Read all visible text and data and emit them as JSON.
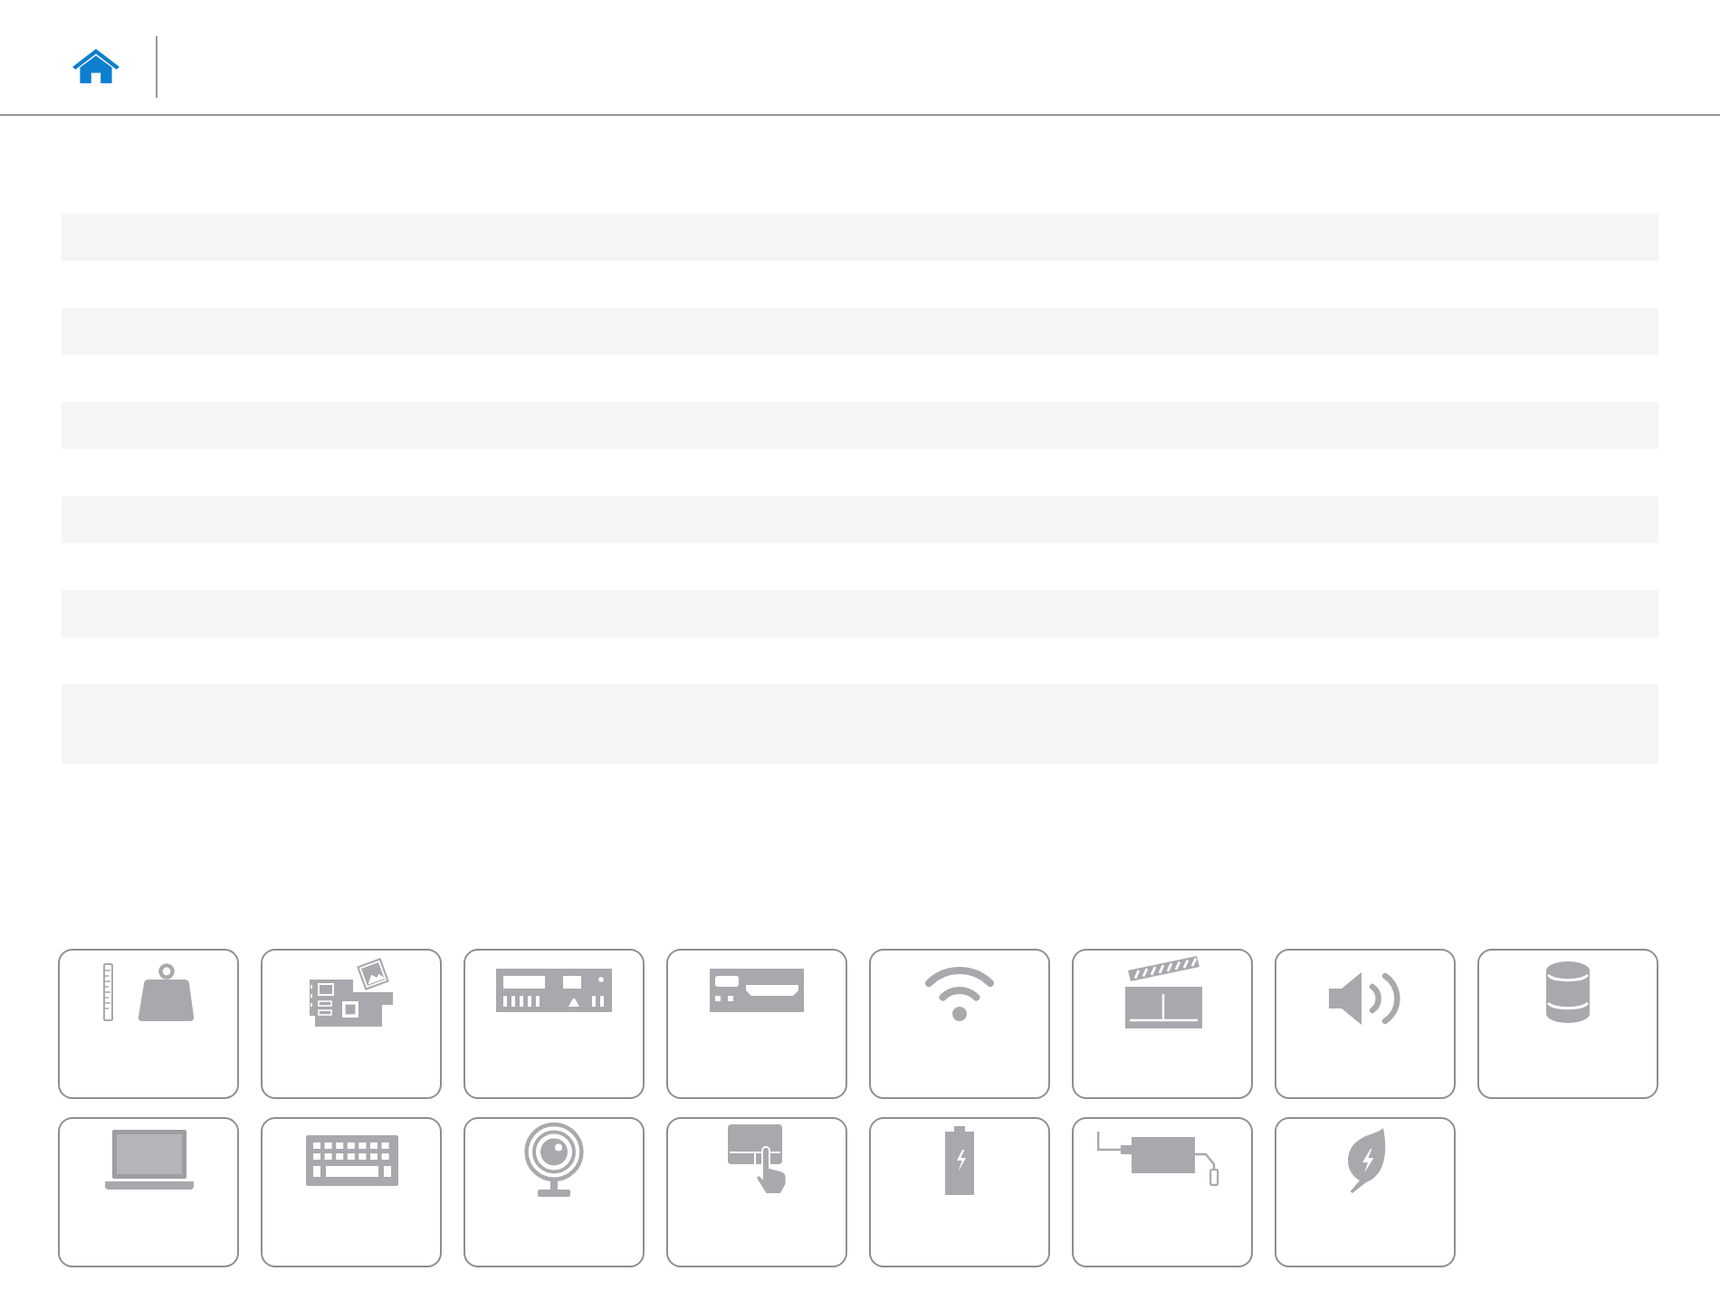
{
  "table": {
    "rows": [
      {
        "kind": "single"
      },
      {
        "kind": "single"
      },
      {
        "kind": "single"
      },
      {
        "kind": "single"
      },
      {
        "kind": "single"
      },
      {
        "kind": "double"
      }
    ]
  },
  "device_tiles": [
    {
      "kind": "weight"
    },
    {
      "kind": "board"
    },
    {
      "kind": "panel"
    },
    {
      "kind": "ports"
    },
    {
      "kind": "wifi"
    },
    {
      "kind": "clapper"
    },
    {
      "kind": "speaker"
    },
    {
      "kind": "cylinder"
    },
    {
      "kind": "laptop"
    },
    {
      "kind": "keyboard"
    },
    {
      "kind": "webcam"
    },
    {
      "kind": "touchpad"
    },
    {
      "kind": "battery"
    },
    {
      "kind": "adapter"
    },
    {
      "kind": "leaf"
    }
  ]
}
